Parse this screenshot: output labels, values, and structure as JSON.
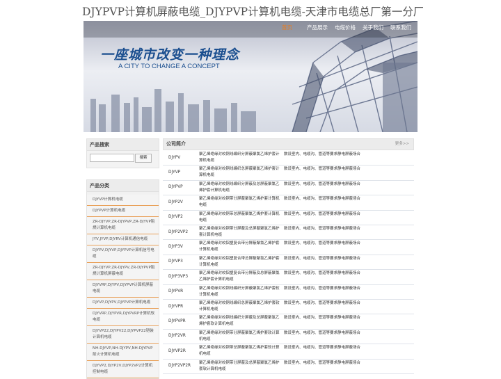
{
  "site": {
    "title": "DJYPVP计算机屏蔽电缆_DJYPVP计算机电缆-天津市电缆总厂第一分厂"
  },
  "nav": [
    "首页",
    "产品展示",
    "电缆价格",
    "关于我们",
    "联系我们"
  ],
  "banner": {
    "slogan": "一座城市改变一种理念",
    "slogan_en": "A CITY TO CHANGE A CONCEPT"
  },
  "sidebar": {
    "search_title": "产品搜索",
    "search_placeholder": "",
    "search_button": "搜索",
    "category_title": "产品分类",
    "categories": [
      "DJYVP计算机电缆",
      "DJYPVP计算机电缆",
      "ZR-DJYVP,ZR-DJYPVP,ZR-DJYVP阻燃计算机电缆",
      "JYV,JYVP,DJYRV计算机通信电缆",
      "DJYPV,DJYVP,DJYPVP计算机信号电缆",
      "ZR-DJYVP,ZR-DJYPV,ZR-DJYPVP阻燃计算机屏蔽电缆",
      "DJYVRP,DJYPV,DJYPVP计算机屏蔽电缆",
      "DJYVP,DJYPV,DJYPVP计算机电缆",
      "DJYVRP,DJYPVR,DJYPVRP计算机软电缆",
      "DJYVP22,DJYPV22,DJYPVP22铠装计算机电缆",
      "NH-DJYVP,NH-DJYPV,NH-DJYPVP耐火计算机电缆",
      "DJYVP2,DJYP2V,DJYP2VP2计算机控制电缆"
    ]
  },
  "main": {
    "title": "公司简介",
    "more": "更多>>",
    "rows": [
      {
        "model": "DJYPV",
        "desc": "聚乙烯绝缘对绞铜线编织分屏蔽聚氯乙烯护套计算机电缆",
        "use": "数设室内、电缆沟、管道等要求静电屏蔽场合"
      },
      {
        "model": "DJYVP",
        "desc": "聚乙烯绝缘对绞铜线编织总屏蔽聚氯乙烯护套计算机电缆",
        "use": "数设室内、电缆沟、管道等要求静电屏蔽场合"
      },
      {
        "model": "DJYPVP",
        "desc": "聚乙烯绝缘对绞铜线编织分屏蔽及总屏蔽聚氯乙烯护套计算机电缆",
        "use": "数设室内、电缆沟、管道等要求静电屏蔽场合"
      },
      {
        "model": "DJYP2V",
        "desc": "聚乙烯绝缘对绞铜带分屏蔽聚氯乙烯护套计算机电缆",
        "use": "数设室内、电缆沟、管道等要求静电屏蔽场合"
      },
      {
        "model": "DJYVP2",
        "desc": "聚乙烯绝缘对绞铜带总屏蔽聚氯乙烯护套计算机电缆",
        "use": "数设室内、电缆沟、管道等要求静电屏蔽场合"
      },
      {
        "model": "DJYP2VP2",
        "desc": "聚乙烯绝缘对绞铜带分屏蔽及总屏蔽聚氯乙烯护套计算机电缆",
        "use": "数设室内、电缆沟、管道等要求静电屏蔽场合"
      },
      {
        "model": "DJYP3V",
        "desc": "聚乙烯绝缘对绞铝塑复合带分屏蔽聚氯乙烯护套计算机电缆",
        "use": "数设室内、电缆沟、管道等要求静电屏蔽场合"
      },
      {
        "model": "DJYVP3",
        "desc": "聚乙烯绝缘对绞铝塑复合带总屏蔽聚氯乙烯护套计算机电缆",
        "use": "数设室内、电缆沟、管道等要求静电屏蔽场合"
      },
      {
        "model": "DJYP3VP3",
        "desc": "聚乙烯绝缘对绞铝塑复合带分屏蔽及总屏蔽聚氯乙烯护套计算机电缆",
        "use": "数设室内、电缆沟、管道等要求静电屏蔽场合"
      },
      {
        "model": "DJYPVR",
        "desc": "聚乙烯绝缘对绞铜线编织分屏蔽聚氯乙烯护套软计算机电缆",
        "use": "数设室内、电缆沟、管道等要求静电屏蔽场合"
      },
      {
        "model": "DJYVPR",
        "desc": "聚乙烯绝缘对绞铜线编织总屏蔽聚氯乙烯护套软计算机电缆",
        "use": "数设室内、电缆沟、管道等要求静电屏蔽场合"
      },
      {
        "model": "DJYPVPR",
        "desc": "聚乙烯绝缘对绞铜线编织分屏蔽及总屏蔽聚氯乙烯护套软计算机电缆",
        "use": "数设室内、电缆沟、管道等要求静电屏蔽场合"
      },
      {
        "model": "DJYP2VR",
        "desc": "聚乙烯绝缘对绞铜带分屏蔽聚氯乙烯护套软计算机电缆",
        "use": "数设室内、电缆沟、管道等要求静电屏蔽场合"
      },
      {
        "model": "DJYVP2R",
        "desc": "聚乙烯绝缘对绞铜带总屏蔽聚氯乙烯护套软计算机电缆",
        "use": "数设室内、电缆沟、管道等要求静电屏蔽场合"
      },
      {
        "model": "DJYP2VP2R",
        "desc": "聚乙烯绝缘对绞铜带分屏蔽及总屏蔽聚氯乙烯护套软计算机电缆",
        "use": "数设室内、电缆沟、管道等要求静电屏蔽场合"
      }
    ]
  },
  "colors": {
    "nav_active": "#e87b1e",
    "slogan": "#1a4e8f",
    "divider": "#e9a15a"
  }
}
